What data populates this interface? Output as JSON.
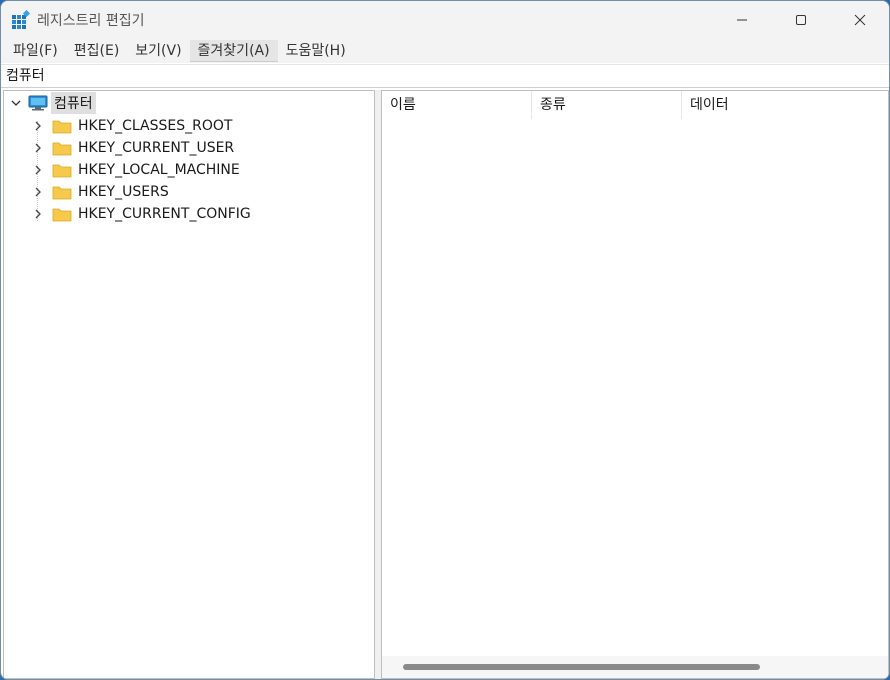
{
  "window": {
    "title": "레지스트리 편집기",
    "icon": "registry-editor-icon"
  },
  "menu": [
    {
      "label": "파일(F)"
    },
    {
      "label": "편집(E)"
    },
    {
      "label": "보기(V)"
    },
    {
      "label": "즐겨찾기(A)"
    },
    {
      "label": "도움말(H)"
    }
  ],
  "address": {
    "path": "컴퓨터"
  },
  "tree": {
    "root": {
      "label": "컴퓨터",
      "expanded": true,
      "selected": true
    },
    "children": [
      {
        "label": "HKEY_CLASSES_ROOT"
      },
      {
        "label": "HKEY_CURRENT_USER"
      },
      {
        "label": "HKEY_LOCAL_MACHINE"
      },
      {
        "label": "HKEY_USERS"
      },
      {
        "label": "HKEY_CURRENT_CONFIG"
      }
    ]
  },
  "list": {
    "columns": [
      "이름",
      "종류",
      "데이터"
    ]
  },
  "colors": {
    "folder": "#f6c94b",
    "selection": "#dfdfdf",
    "scroll_thumb": "#8a8a8a"
  }
}
